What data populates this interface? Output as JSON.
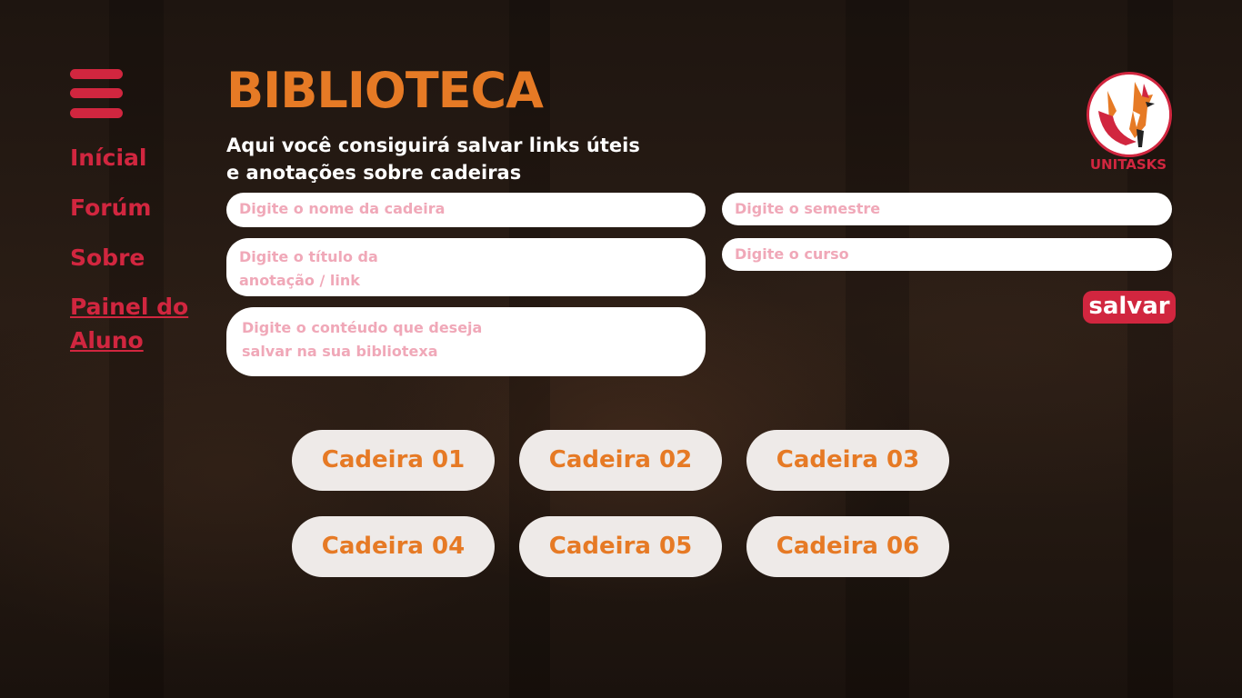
{
  "colors": {
    "accent": "#d1263f",
    "title": "#e67a25",
    "field_bg": "#ffffff",
    "placeholder": "#f0a8b8",
    "card_bg": "#eeeae8"
  },
  "menu": {
    "icon": "hamburger-menu-icon"
  },
  "nav": {
    "items": [
      {
        "label": "Inícial"
      },
      {
        "label": "Forúm"
      },
      {
        "label": "Sobre"
      },
      {
        "label": "Painel do Aluno"
      }
    ]
  },
  "header": {
    "title": "BIBLIOTECA",
    "subtitle": "Aqui você consiguirá salvar links úteis e anotações sobre cadeiras"
  },
  "form": {
    "cadeira_placeholder": "Digite o nome da cadeira",
    "semestre_placeholder": "Digite o semestre",
    "titulo_placeholder": "Digite o título da\nanotação / link",
    "curso_placeholder": "Digite o curso",
    "conteudo_placeholder": "Digite o contéudo que deseja\nsalvar na sua bibliotexa",
    "save_label": "salvar"
  },
  "logo": {
    "text": "UNITASKS",
    "icon": "fox-logo-icon"
  },
  "courses": [
    {
      "label": "Cadeira 01"
    },
    {
      "label": "Cadeira 02"
    },
    {
      "label": "Cadeira 03"
    },
    {
      "label": "Cadeira 04"
    },
    {
      "label": "Cadeira 05"
    },
    {
      "label": "Cadeira 06"
    }
  ]
}
